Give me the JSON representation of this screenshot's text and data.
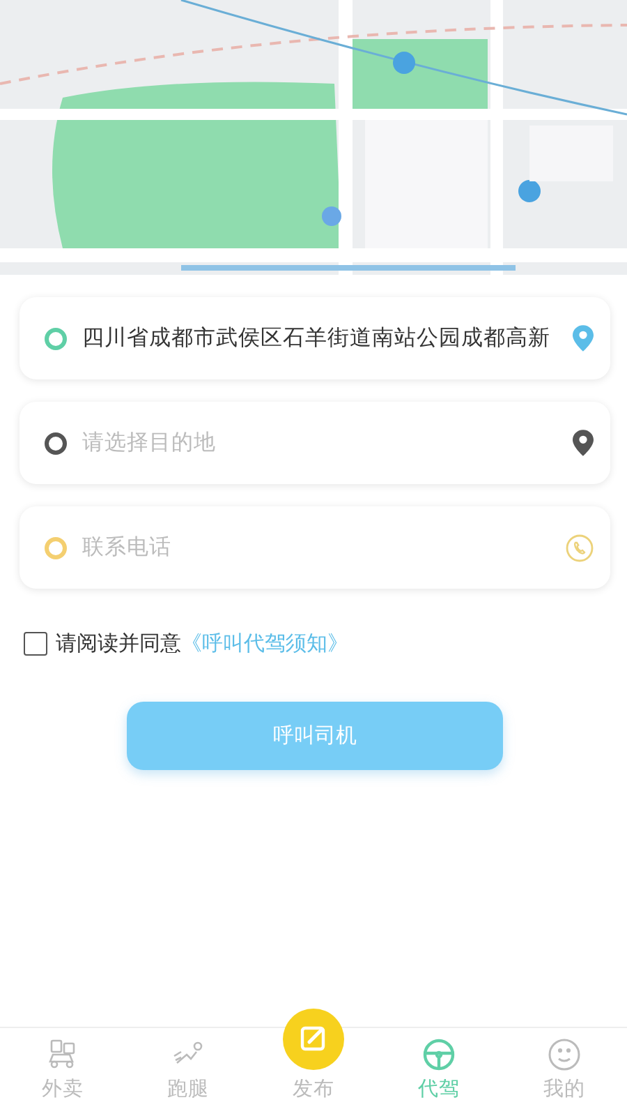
{
  "fields": [
    {
      "kind": "pickup",
      "value": "四川省成都市武侯区石羊街道南站公园成都高新",
      "color": "#5fcfa6"
    },
    {
      "kind": "destination",
      "placeholder": "请选择目的地",
      "color": "#555555"
    },
    {
      "kind": "phone",
      "placeholder": "联系电话",
      "color": "#f4cf70"
    }
  ],
  "agreement": {
    "checked": false,
    "text": "请阅读并同意",
    "link": "《呼叫代驾须知》"
  },
  "call_button": "呼叫司机",
  "nav": [
    {
      "kind": "takeout",
      "label": "外卖",
      "selected": false
    },
    {
      "kind": "errand",
      "label": "跑腿",
      "selected": false
    },
    {
      "kind": "publish",
      "label": "发布",
      "selected": false
    },
    {
      "kind": "driver",
      "label": "代驾",
      "selected": true
    },
    {
      "kind": "profile",
      "label": "我的",
      "selected": false
    }
  ]
}
